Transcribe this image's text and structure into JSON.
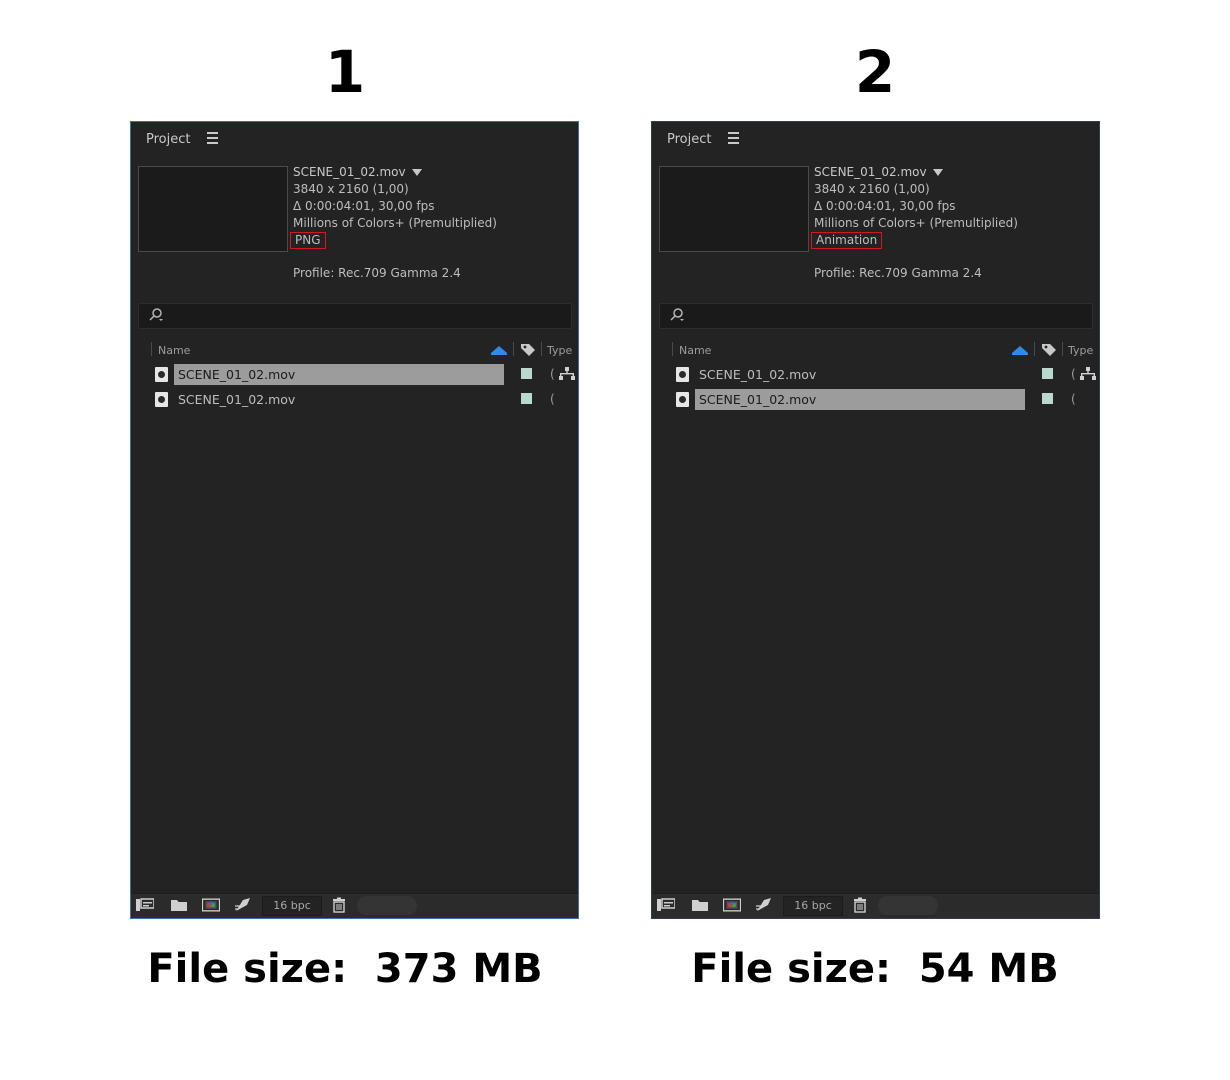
{
  "comparisons": [
    {
      "number": "1",
      "file_size": "File size:  373 MB",
      "panel": {
        "title": "Project",
        "info": {
          "filename": "SCENE_01_02.mov",
          "resolution": "3840 x 2160 (1,00)",
          "duration_fps": "Δ 0:00:04:01, 30,00 fps",
          "colors": "Millions of Colors+ (Premultiplied)",
          "codec": "PNG",
          "profile": "Profile: Rec.709 Gamma 2.4"
        },
        "columns": {
          "name": "Name",
          "type": "Type"
        },
        "items": [
          {
            "name": "SCENE_01_02.mov",
            "type_trunc": "(",
            "selected": true
          },
          {
            "name": "SCENE_01_02.mov",
            "type_trunc": "(",
            "selected": false
          }
        ],
        "bit_depth": "16 bpc"
      }
    },
    {
      "number": "2",
      "file_size": "File size:  54 MB",
      "panel": {
        "title": "Project",
        "info": {
          "filename": "SCENE_01_02.mov",
          "resolution": "3840 x 2160 (1,00)",
          "duration_fps": "Δ 0:00:04:01, 30,00 fps",
          "colors": "Millions of Colors+ (Premultiplied)",
          "codec": "Animation",
          "profile": "Profile: Rec.709 Gamma 2.4"
        },
        "columns": {
          "name": "Name",
          "type": "Type"
        },
        "items": [
          {
            "name": "SCENE_01_02.mov",
            "type_trunc": "(",
            "selected": false
          },
          {
            "name": "SCENE_01_02.mov",
            "type_trunc": "(",
            "selected": true
          }
        ],
        "bit_depth": "16 bpc"
      }
    }
  ],
  "colors": {
    "panel_bg": "#232323",
    "highlight_box": "#d11a1a",
    "selection": "#9c9c9c",
    "sort_accent": "#2d8ceb",
    "label_swatch": "#b9d9cf"
  }
}
